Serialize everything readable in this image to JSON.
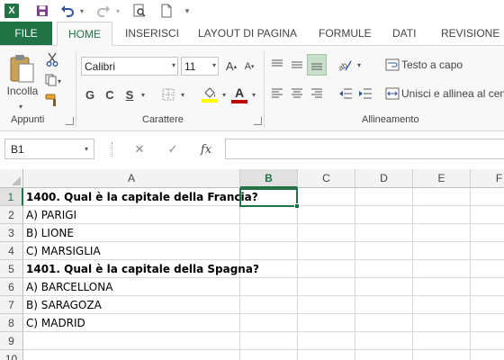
{
  "app": {
    "logo_letter": "X"
  },
  "tabs": [
    "FILE",
    "HOME",
    "INSERISCI",
    "LAYOUT DI PAGINA",
    "FORMULE",
    "DATI",
    "REVISIONE"
  ],
  "active_tab": "HOME",
  "ribbon": {
    "clipboard": {
      "paste_label": "Incolla",
      "group_label": "Appunti"
    },
    "font": {
      "family": "Calibri",
      "size": "11",
      "grow": "A",
      "shrink": "A",
      "bold": "G",
      "italic": "C",
      "underline": "S",
      "highlight": "ab",
      "font_color_letter": "A",
      "group_label": "Carattere"
    },
    "alignment": {
      "wrap_text": "Testo a capo",
      "merge_center": "Unisci e allinea al centro",
      "group_label": "Allineamento"
    }
  },
  "formula_bar": {
    "name_box": "B1",
    "cancel": "✕",
    "enter": "✓",
    "fx": "fx",
    "value": ""
  },
  "grid": {
    "columns": [
      "A",
      "B",
      "C",
      "D",
      "E",
      "F"
    ],
    "selected_column": "B",
    "selected_row": 1,
    "rows": [
      {
        "n": "1",
        "a": "1400. Qual è la capitale della Francia?",
        "bold": true
      },
      {
        "n": "2",
        "a": "A) PARIGI",
        "bold": false
      },
      {
        "n": "3",
        "a": "B) LIONE",
        "bold": false
      },
      {
        "n": "4",
        "a": "C) MARSIGLIA",
        "bold": false
      },
      {
        "n": "5",
        "a": "1401. Qual è la capitale della Spagna?",
        "bold": true
      },
      {
        "n": "6",
        "a": "A) BARCELLONA",
        "bold": false
      },
      {
        "n": "7",
        "a": "B) SARAGOZA",
        "bold": false
      },
      {
        "n": "8",
        "a": "C) MADRID",
        "bold": false
      },
      {
        "n": "9",
        "a": "",
        "bold": false
      },
      {
        "n": "10",
        "a": "",
        "bold": false
      }
    ]
  },
  "colors": {
    "accent": "#217346",
    "highlight_bar": "#ffff00",
    "font_color_bar": "#c00000"
  }
}
